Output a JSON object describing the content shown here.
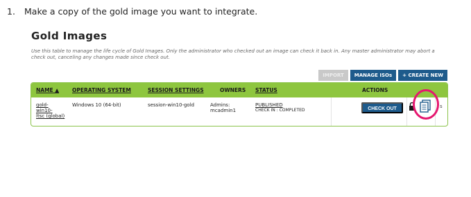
{
  "step": {
    "number": "1.",
    "text": "Make a copy of the gold image you want to integrate."
  },
  "page": {
    "title": "Gold Images",
    "description": "Use this table to manage the life cycle of Gold Images. Only the administrator who checked out an image can check it back in. Any master administrator may abort a check out, canceling any changes made since check out."
  },
  "toolbar": {
    "import_label": "IMPORT",
    "manage_label": "MANAGE ISOs",
    "create_label": "+ CREATE NEW"
  },
  "table": {
    "columns": {
      "name": "NAME ▲",
      "os": "OPERATING SYSTEM",
      "session": "SESSION SETTINGS",
      "owners": "OWNERS",
      "status": "STATUS",
      "actions": "ACTIONS"
    },
    "rows": [
      {
        "name_lines": [
          "gold-",
          "win10-",
          "ltsc (global)"
        ],
        "os": "Windows 10 (64-bit)",
        "session": "session-win10-gold",
        "owners_lines": [
          "Admins:",
          "mcadmin1"
        ],
        "status": "PUBLISHED",
        "status_detail": "CHECK IN : COMPLETED",
        "checkout_label": "CHECK OUT",
        "trailing_text": "s"
      }
    ]
  },
  "colors": {
    "header_green": "#8ec63f",
    "button_blue": "#1e5b8c",
    "highlight_pink": "#e5176f"
  },
  "icons": [
    "lock-icon",
    "copy-icon"
  ]
}
